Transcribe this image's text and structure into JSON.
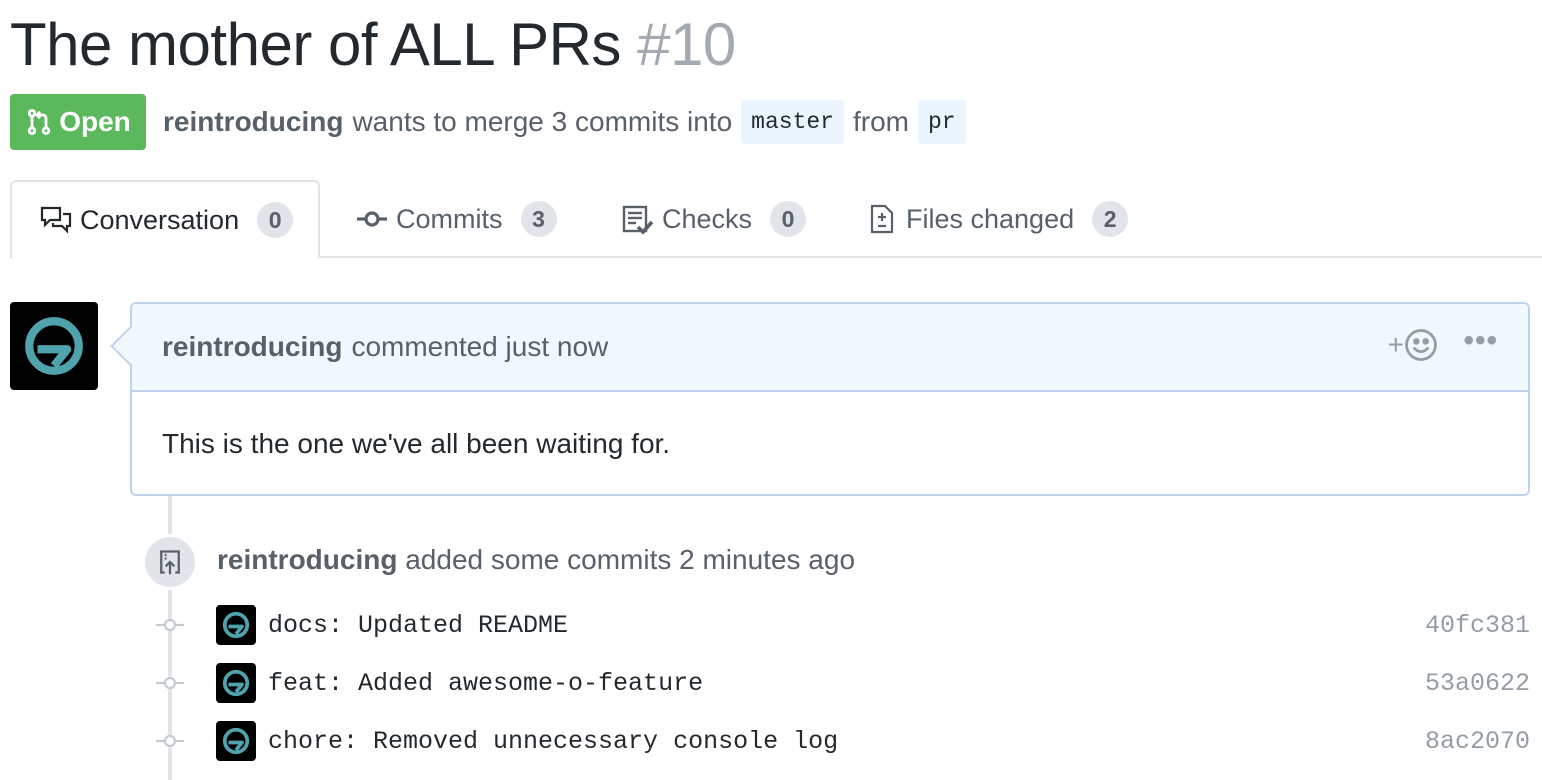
{
  "pr": {
    "title": "The mother of ALL PRs",
    "number": "#10",
    "state": "Open",
    "author": "reintroducing",
    "meta_wants": "wants to merge 3 commits into",
    "base_branch": "master",
    "meta_from": "from",
    "head_branch": "pr"
  },
  "tabs": [
    {
      "label": "Conversation",
      "count": "0",
      "icon": "comment-discussion-icon"
    },
    {
      "label": "Commits",
      "count": "3",
      "icon": "git-commit-icon"
    },
    {
      "label": "Checks",
      "count": "0",
      "icon": "checklist-icon"
    },
    {
      "label": "Files changed",
      "count": "2",
      "icon": "diff-icon"
    }
  ],
  "comment": {
    "author": "reintroducing",
    "action": "commented just now",
    "reaction_plus": "+",
    "more": "•••",
    "body": "This is the one we've all been waiting for."
  },
  "event": {
    "author": "reintroducing",
    "action": "added some commits 2 minutes ago"
  },
  "commits": [
    {
      "message": "docs: Updated README",
      "sha": "40fc381"
    },
    {
      "message": "feat: Added awesome-o-feature",
      "sha": "53a0622"
    },
    {
      "message": "chore: Removed unnecessary console log",
      "sha": "8ac2070"
    }
  ],
  "colors": {
    "open_green": "#5cb85c",
    "avatar_teal": "#4fa3ad",
    "comment_border": "#c0d3eb",
    "comment_header_bg": "#f1f8ff"
  }
}
